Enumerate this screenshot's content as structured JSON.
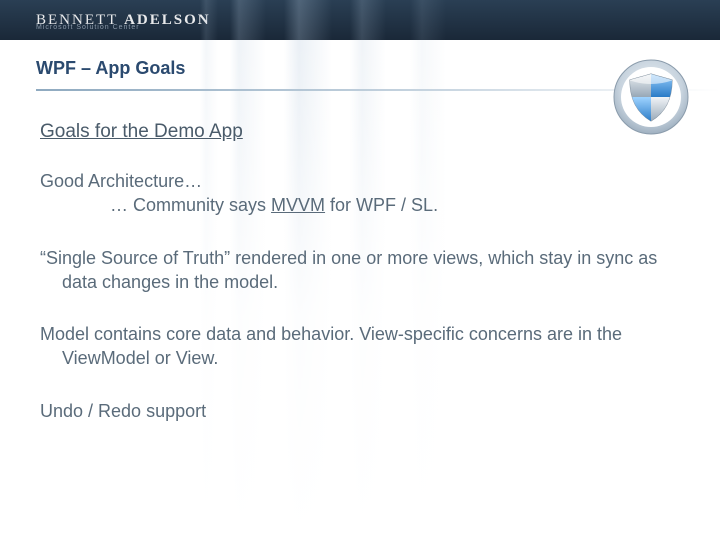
{
  "brand": {
    "name_light": "BENNETT",
    "name_bold": "ADELSON",
    "tagline": "Microsoft Solution Center"
  },
  "slide": {
    "title": "WPF – App Goals",
    "subtitle": "Goals for the Demo App",
    "bullets": {
      "b1_line1": "Good Architecture…",
      "b1_line2_prefix": "… Community says ",
      "b1_line2_em": "MVVM",
      "b1_line2_suffix": " for WPF / SL.",
      "b2": "“Single Source of Truth” rendered in one or more views, which stay in sync as data changes in the model.",
      "b3": "Model contains core data and behavior. View-specific concerns are in the ViewModel or View.",
      "b4": "Undo / Redo support"
    }
  }
}
